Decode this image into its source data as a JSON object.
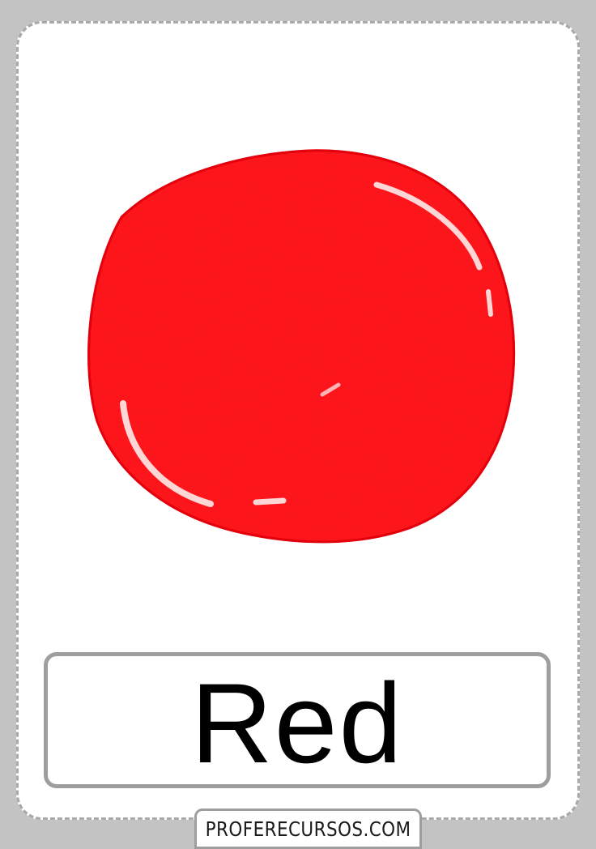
{
  "card": {
    "word": "Red",
    "color_swatch": {
      "name": "red-paint-blob",
      "fill": "#ff1a1a",
      "highlight": "#ffd6d6",
      "outline": "#e10000"
    }
  },
  "footer": {
    "website": "PROFERECURSOS.COM"
  },
  "colors": {
    "background": "#c3c3c3",
    "card": "#ffffff",
    "border": "#9e9e9e",
    "text": "#000000"
  }
}
